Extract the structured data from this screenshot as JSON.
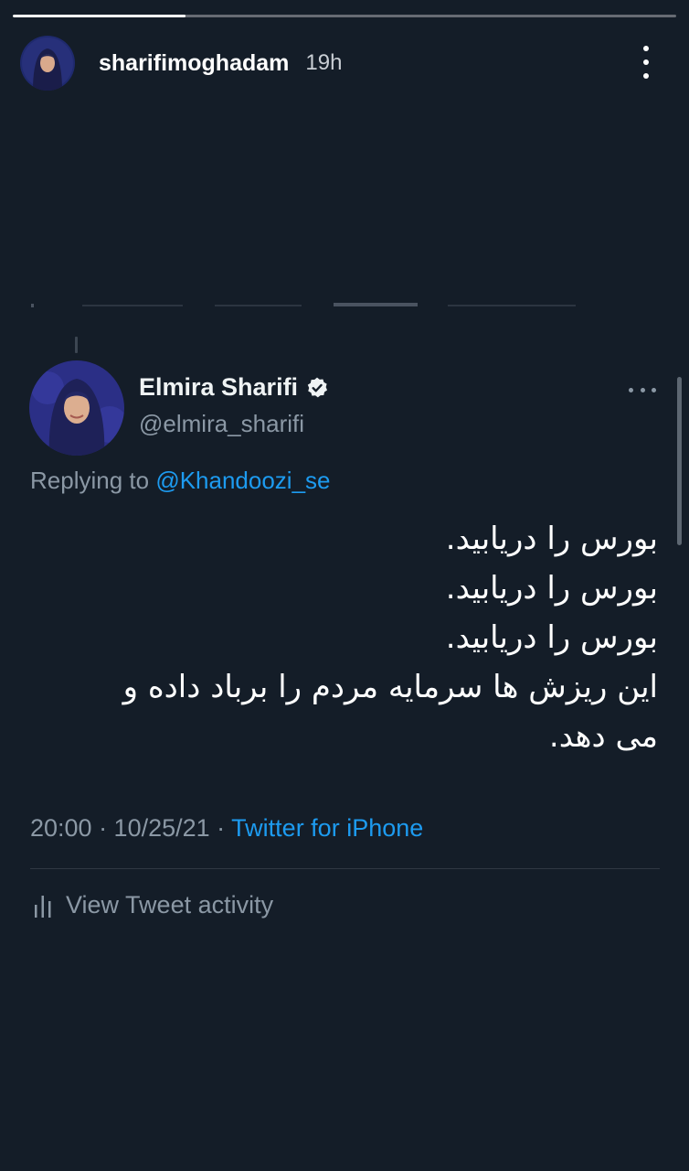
{
  "story": {
    "username": "sharifimoghadam",
    "time": "19h",
    "progress": 0.26,
    "avatar_icon": "profile-photo"
  },
  "tweet": {
    "display_name": "Elmira Sharifi",
    "handle": "@elmira_sharifi",
    "replying_prefix": "Replying to",
    "replying_mention": "@Khandoozi_se",
    "body_lines": [
      "بورس را دریابید.",
      "بورس را دریابید.",
      "بورس را دریابید.",
      "این ریزش ها سرمایه مردم را برباد داده و",
      "می دهد."
    ],
    "timestamp": "20:00 · 10/25/21 ·",
    "source": "Twitter for iPhone",
    "activity_label": "View Tweet activity"
  },
  "colors": {
    "background": "#141d28",
    "accent": "#1d9bf0",
    "secondary_text": "#8b98a5"
  }
}
